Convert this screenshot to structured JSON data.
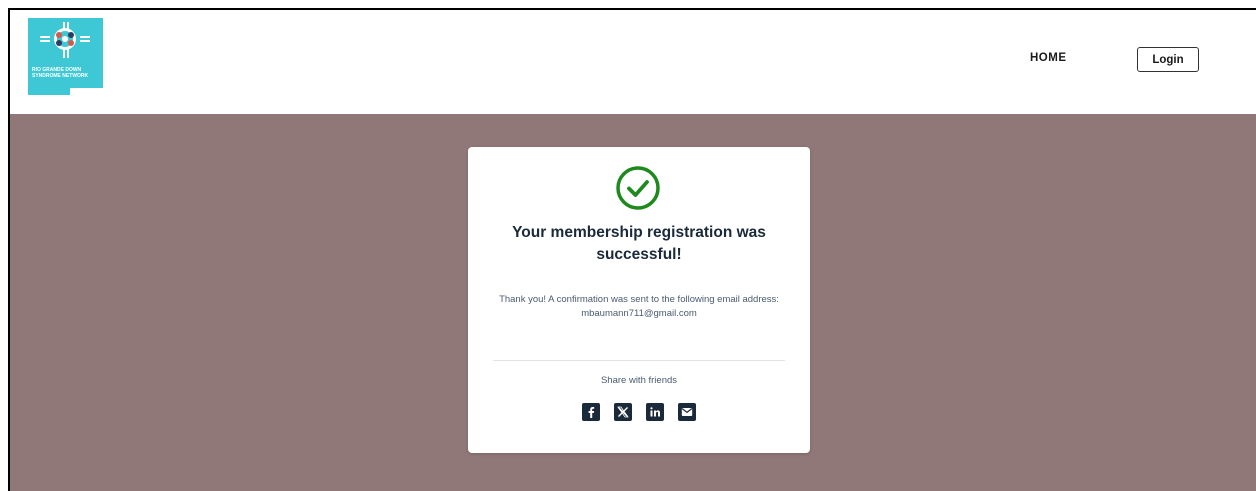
{
  "header": {
    "logo_text": "RIO GRANDE DOWN SYNDROME NETWORK",
    "nav": {
      "home_label": "HOME",
      "login_label": "Login"
    }
  },
  "card": {
    "title": "Your membership registration was successful!",
    "message": "Thank you! A confirmation was sent to the following email address: mbaumann711@gmail.com",
    "share_label": "Share with friends",
    "social": [
      "facebook-icon",
      "x-icon",
      "linkedin-icon",
      "email-icon"
    ]
  },
  "colors": {
    "page_bg": "#8f7877",
    "logo_bg": "#3ec8d6",
    "success_green": "#1e8a1e",
    "text_dark": "#1b2a3a",
    "social_bg": "#1b2a3a"
  }
}
